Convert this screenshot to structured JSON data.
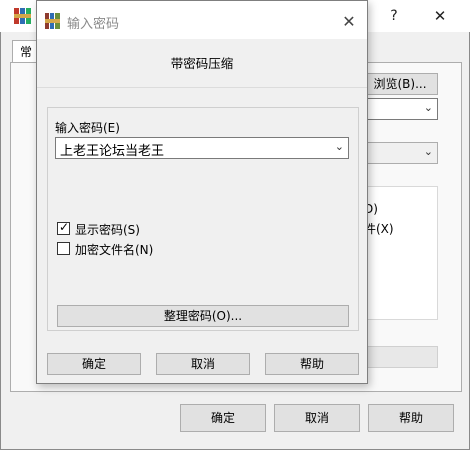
{
  "back_window": {
    "help_glyph": "?",
    "close_glyph": "✕",
    "tab_first_partial": "常",
    "browse_button": "浏览(B)...",
    "option_1_partial": "D)",
    "option_2_partial": "件(X)",
    "ok_button": "确定",
    "cancel_button": "取消",
    "help_button": "帮助"
  },
  "dialog": {
    "title": "输入密码",
    "close_glyph": "✕",
    "heading": "带密码压缩",
    "password_label": "输入密码(E)",
    "password_value": "上老王论坛当老王",
    "show_password_label": "显示密码(S)",
    "show_password_checked": true,
    "encrypt_names_label": "加密文件名(N)",
    "encrypt_names_checked": false,
    "organize_button": "整理密码(O)...",
    "ok_button": "确定",
    "cancel_button": "取消",
    "help_button": "帮助"
  }
}
